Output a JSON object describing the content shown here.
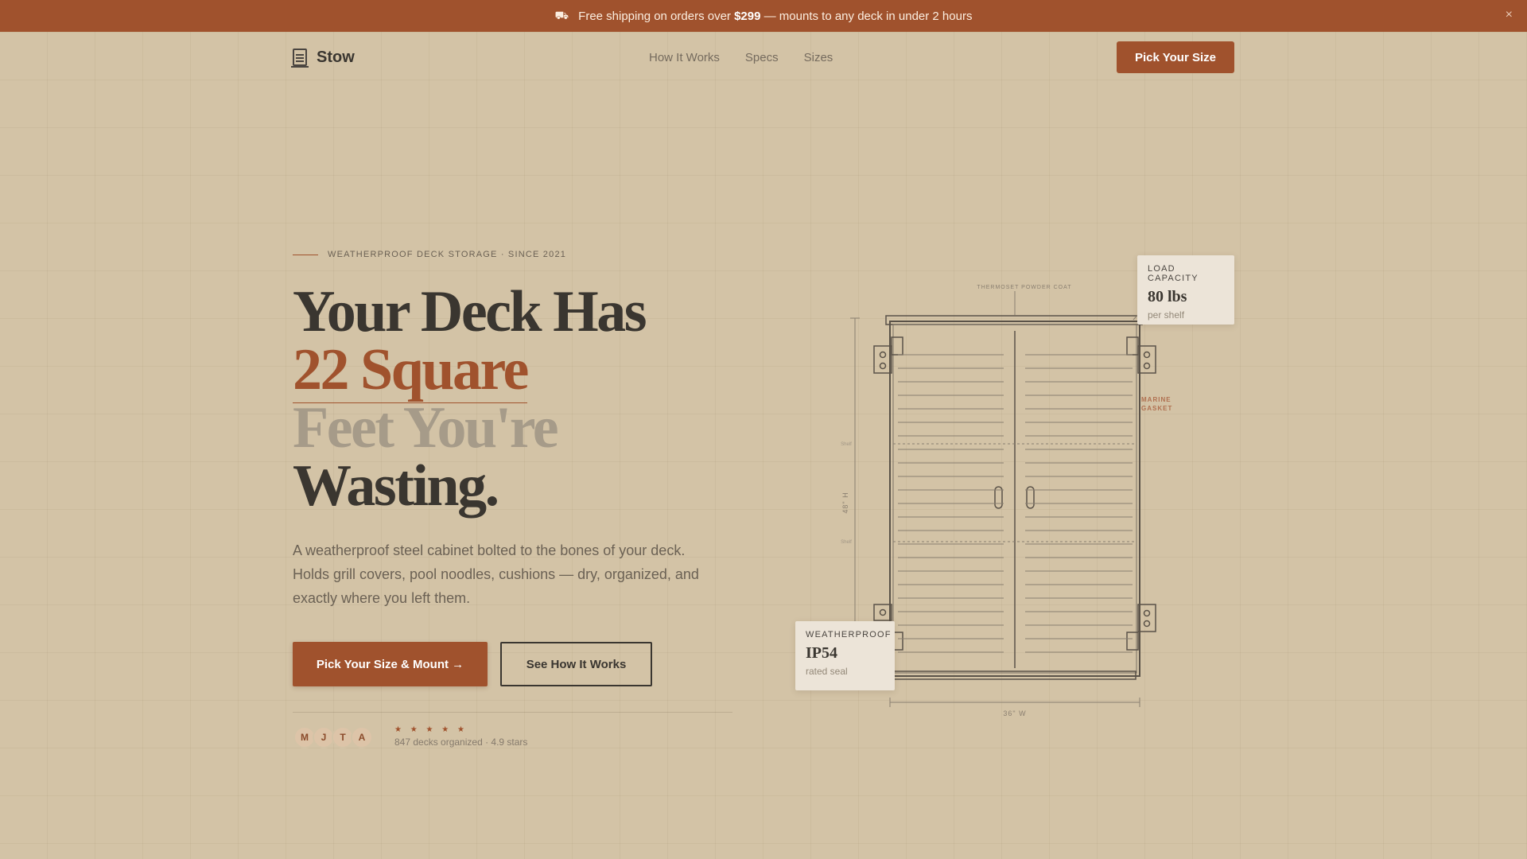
{
  "announcement": {
    "icon": "truck-icon",
    "text_before": "Free shipping on orders over ",
    "amount": "$299",
    "text_after": " — mounts to any deck in under 2 hours",
    "close": "×"
  },
  "nav": {
    "brand": "Stow",
    "links": [
      "How It Works",
      "Specs",
      "Sizes"
    ],
    "cta": "Pick Your Size"
  },
  "hero": {
    "eyebrow": "WEATHERPROOF DECK STORAGE · SINCE 2021",
    "headline": {
      "line1": "Your Deck Has",
      "line2": "22 Square",
      "line3": "Feet You're",
      "line4": "Wasting."
    },
    "lede": "A weatherproof steel cabinet bolted to the bones of your deck. Holds grill covers, pool noodles, cushions — dry, organized, and exactly where you left them.",
    "primary_cta": "Pick Your Size & Mount →",
    "secondary_cta": "See How It Works",
    "avatars": [
      "M",
      "J",
      "T",
      "A"
    ],
    "stars": "★ ★ ★ ★ ★",
    "proof": "847 decks organized · 4.9 stars"
  },
  "diagram": {
    "top_label": "THERMOSET POWDER COAT",
    "side_label": "MARINE GASKET",
    "side_label_line1": "MARINE",
    "side_label_line2": "GASKET",
    "height_label": "48\" H",
    "width_label": "36\" W",
    "shelf_label_1": "Shelf",
    "shelf_label_2": "Shelf",
    "load_card": {
      "key": "LOAD CAPACITY",
      "value": "80 lbs",
      "sub": "per shelf"
    },
    "ip_card": {
      "key": "WEATHERPROOF",
      "value": "IP54",
      "sub": "rated seal"
    }
  },
  "colors": {
    "background": "#d3c3a6",
    "accent": "#a0522d",
    "ink": "#3a3630",
    "muted": "#a69b89"
  }
}
